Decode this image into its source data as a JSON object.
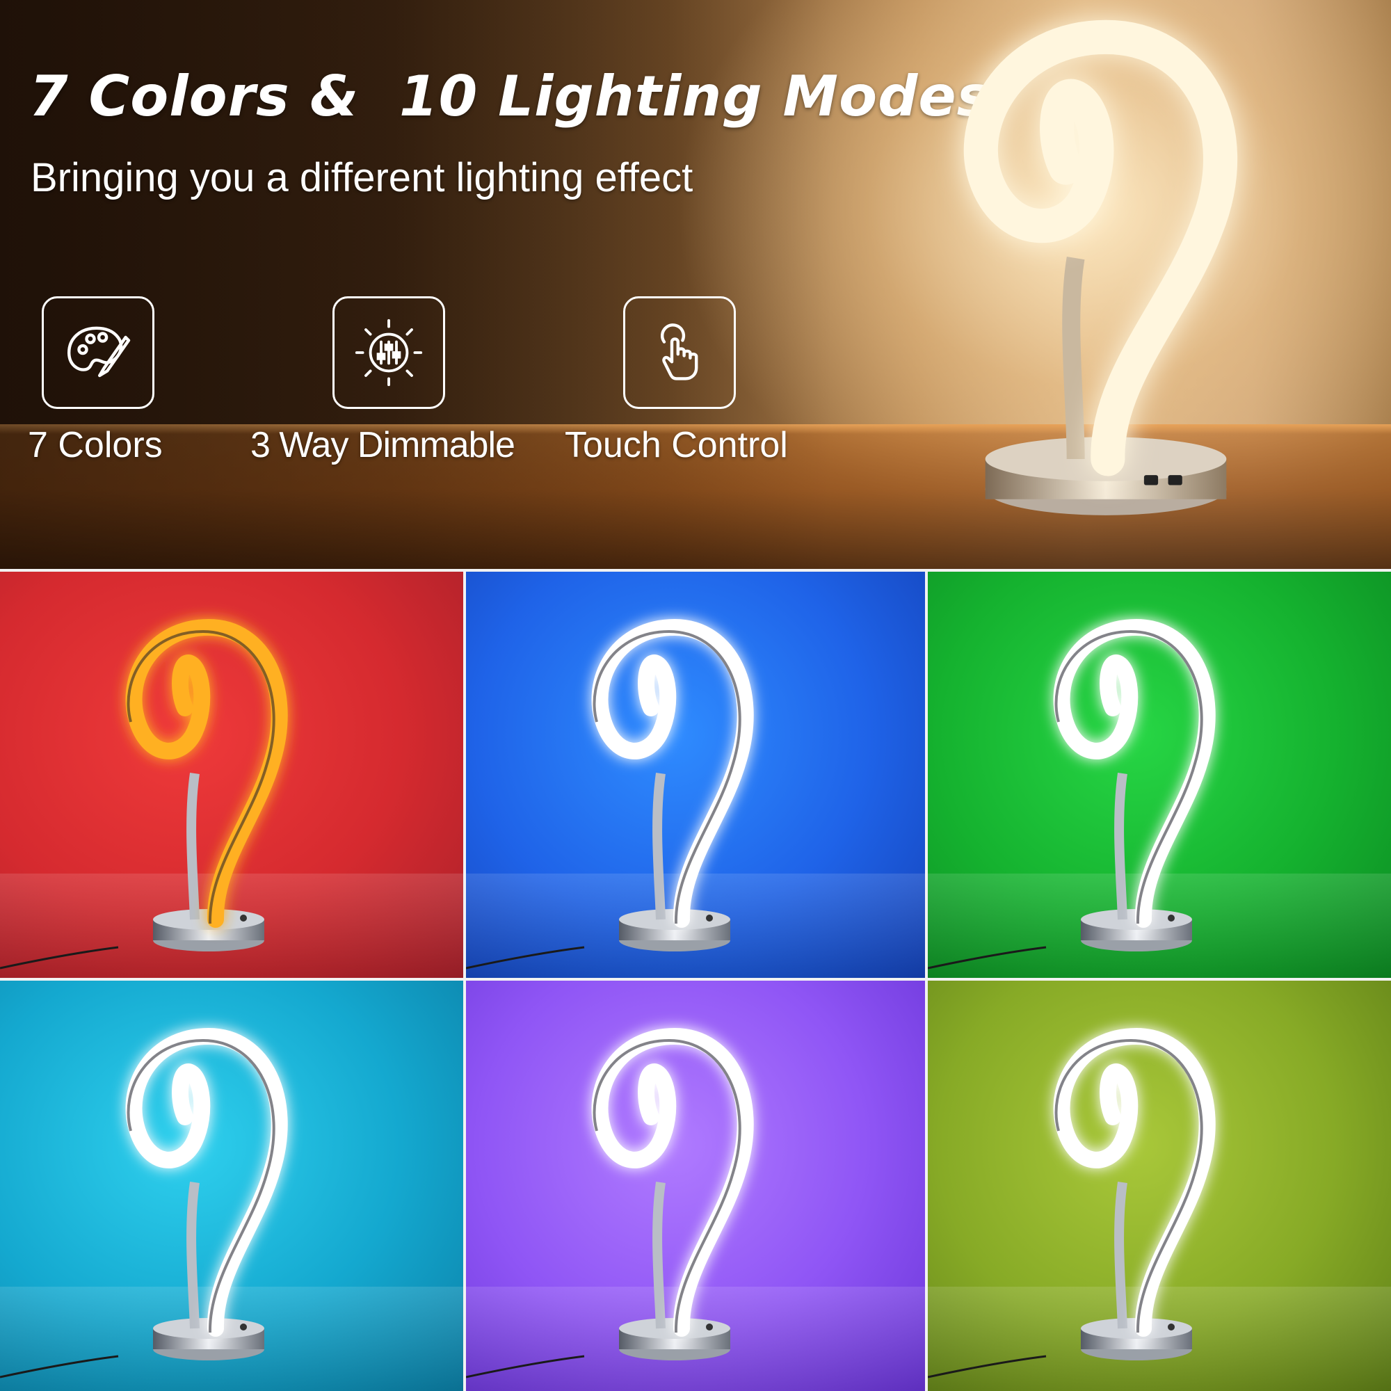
{
  "hero": {
    "headline": "7 Colors &  10 Lighting Modes",
    "subline": "Bringing you a different lighting effect"
  },
  "features": [
    {
      "label": "7 Colors",
      "icon": "palette-icon"
    },
    {
      "label": "3 Way Dimmable",
      "icon": "dimmer-sliders-icon"
    },
    {
      "label": "Touch Control",
      "icon": "touch-hand-icon"
    }
  ],
  "tiles": [
    {
      "name": "red",
      "bg": "#d52a2f",
      "glow": "#ffb020"
    },
    {
      "name": "blue",
      "bg": "#1f63e8",
      "glow": "#ffffff"
    },
    {
      "name": "green",
      "bg": "#15b22f",
      "glow": "#ffffff"
    },
    {
      "name": "cyan",
      "bg": "#14a8cf",
      "glow": "#ffffff"
    },
    {
      "name": "purple",
      "bg": "#8f55f5",
      "glow": "#ffffff"
    },
    {
      "name": "yellow-green",
      "bg": "#87aa26",
      "glow": "#ffffff"
    }
  ],
  "colors": {
    "warm_glow": "#fff4d8",
    "chrome": "#c8ccd2",
    "text": "#ffffff"
  }
}
